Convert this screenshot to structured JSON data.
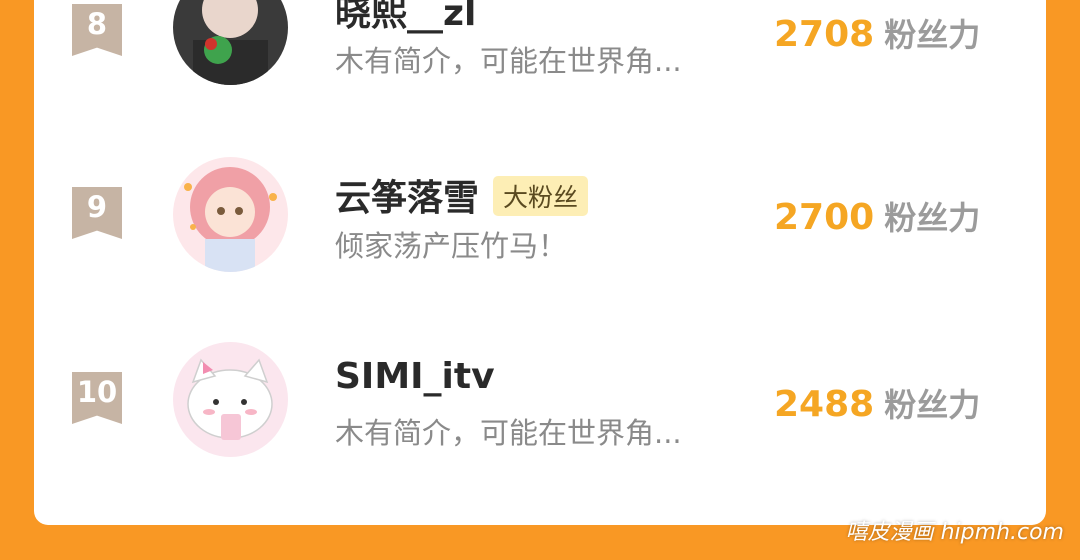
{
  "ranking": [
    {
      "rank": "8",
      "name": "晓熙__zl",
      "badge": "",
      "intro": "木有简介，可能在世界角...",
      "score": "2708",
      "score_unit": "粉丝力"
    },
    {
      "rank": "9",
      "name": "云筝落雪",
      "badge": "大粉丝",
      "intro": "倾家荡产压竹马！",
      "score": "2700",
      "score_unit": "粉丝力"
    },
    {
      "rank": "10",
      "name": "SIMI_itv",
      "badge": "",
      "intro": "木有简介，可能在世界角...",
      "score": "2488",
      "score_unit": "粉丝力"
    }
  ],
  "watermark": "嘻皮漫画 hipmh.com",
  "colors": {
    "background": "#f99824",
    "score": "#f5a623",
    "badge_bg": "#fdeeb5",
    "rank_ribbon": "#c6b4a4"
  }
}
